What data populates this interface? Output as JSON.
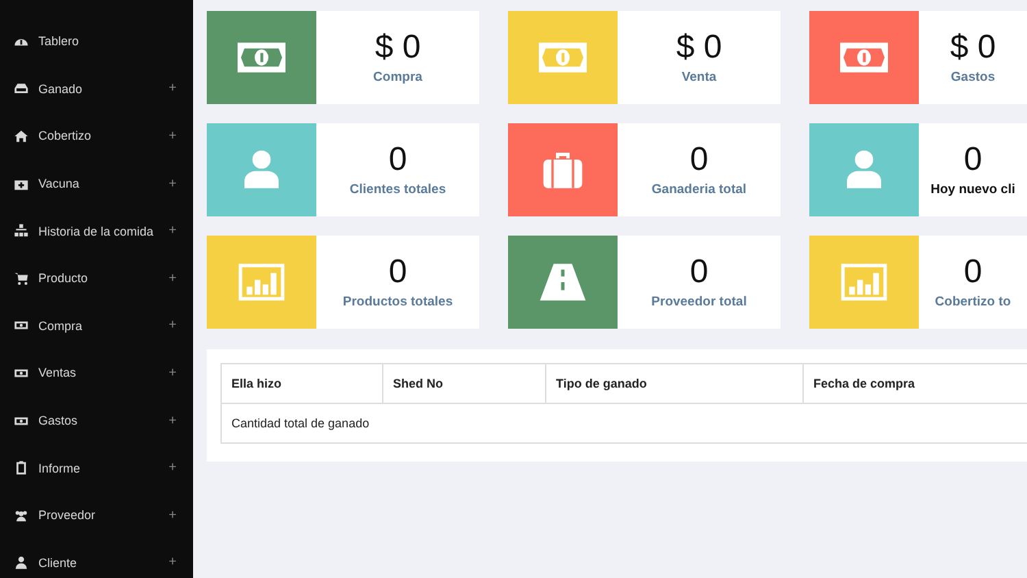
{
  "sidebar": {
    "items": [
      {
        "label": "Tablero",
        "kind": "dashboard"
      },
      {
        "label": "Ganado",
        "kind": "tray",
        "expander": "+"
      },
      {
        "label": "Cobertizo",
        "kind": "home",
        "expander": "+"
      },
      {
        "label": "Vacuna",
        "kind": "medkit",
        "expander": "+"
      },
      {
        "label": "Historia de la comida",
        "kind": "sitemap",
        "expander": "+"
      },
      {
        "label": "Producto",
        "kind": "cart",
        "expander": "+"
      },
      {
        "label": "Compra",
        "kind": "money",
        "expander": "+"
      },
      {
        "label": "Ventas",
        "kind": "money",
        "expander": "+"
      },
      {
        "label": "Gastos",
        "kind": "money",
        "expander": "+"
      },
      {
        "label": "Informe",
        "kind": "clipboard",
        "expander": "+"
      },
      {
        "label": "Proveedor",
        "kind": "users",
        "expander": "+"
      },
      {
        "label": "Cliente",
        "kind": "user",
        "expander": "+"
      }
    ]
  },
  "cards": [
    {
      "value": "$ 0",
      "label": "Compra",
      "kind": "money",
      "color": "#5b9668",
      "emphasis": false
    },
    {
      "value": "$ 0",
      "label": "Venta",
      "kind": "money",
      "color": "#f6d043",
      "emphasis": false
    },
    {
      "value": "$ 0",
      "label": "Gastos",
      "kind": "money",
      "color": "#fd6b5b",
      "emphasis": false
    },
    {
      "value": "0",
      "label": "Clientes totales",
      "kind": "user",
      "color": "#6ccac9",
      "emphasis": false
    },
    {
      "value": "0",
      "label": "Ganaderia total",
      "kind": "briefcase",
      "color": "#fd6b5b",
      "emphasis": false
    },
    {
      "value": "0",
      "label": "Hoy nuevo cli",
      "kind": "user",
      "color": "#6ccac9",
      "emphasis": true
    },
    {
      "value": "0",
      "label": "Productos totales",
      "kind": "chart",
      "color": "#f6d043",
      "emphasis": false
    },
    {
      "value": "0",
      "label": "Proveedor total",
      "kind": "road",
      "color": "#5b9668",
      "emphasis": false
    },
    {
      "value": "0",
      "label": "Cobertizo to",
      "kind": "chart",
      "color": "#f6d043",
      "emphasis": false
    }
  ],
  "table": {
    "columns": [
      "Ella hizo",
      "Shed No",
      "Tipo de ganado",
      "Fecha de compra"
    ],
    "footer": "Cantidad total de ganado"
  }
}
